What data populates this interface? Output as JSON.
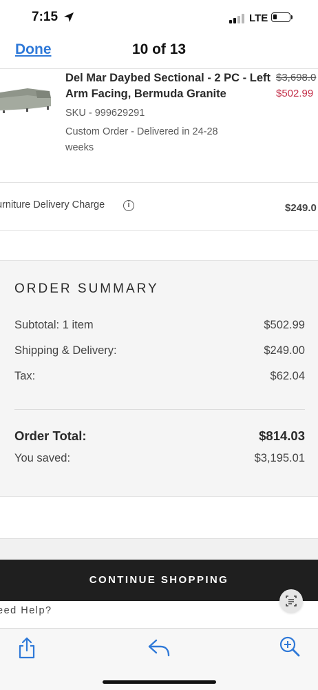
{
  "status_bar": {
    "time": "7:15",
    "network": "LTE"
  },
  "nav": {
    "done_label": "Done",
    "title": "10 of 13"
  },
  "product": {
    "title": "Del Mar Daybed Sectional - 2 PC - Left Arm Facing, Bermuda Granite",
    "original_price": "$3,698.0",
    "sale_price": "$502.99",
    "sku": "SKU - 999629291",
    "delivery_note": "Custom Order - Delivered in 24-28 weeks"
  },
  "delivery_charge": {
    "label": "urniture Delivery Charge",
    "price": "$249.0"
  },
  "summary": {
    "heading": "ORDER SUMMARY",
    "rows": [
      {
        "label": "Subtotal: 1 item",
        "value": "$502.99"
      },
      {
        "label": "Shipping & Delivery:",
        "value": "$249.00"
      },
      {
        "label": "Tax:",
        "value": "$62.04"
      }
    ],
    "total_label": "Order Total:",
    "total_value": "$814.03",
    "saved_label": "You saved:",
    "saved_value": "$3,195.01"
  },
  "continue_label": "CONTINUE SHOPPING",
  "need_help": "eed Help?",
  "icons": {
    "location": "location-arrow-icon",
    "share": "share-icon",
    "reply": "reply-icon",
    "zoom": "zoom-in-icon",
    "info": "info-icon",
    "scan": "scan-text-icon"
  },
  "colors": {
    "link": "#2f79d8",
    "sale": "#c4314b",
    "button": "#1f1f1f"
  }
}
